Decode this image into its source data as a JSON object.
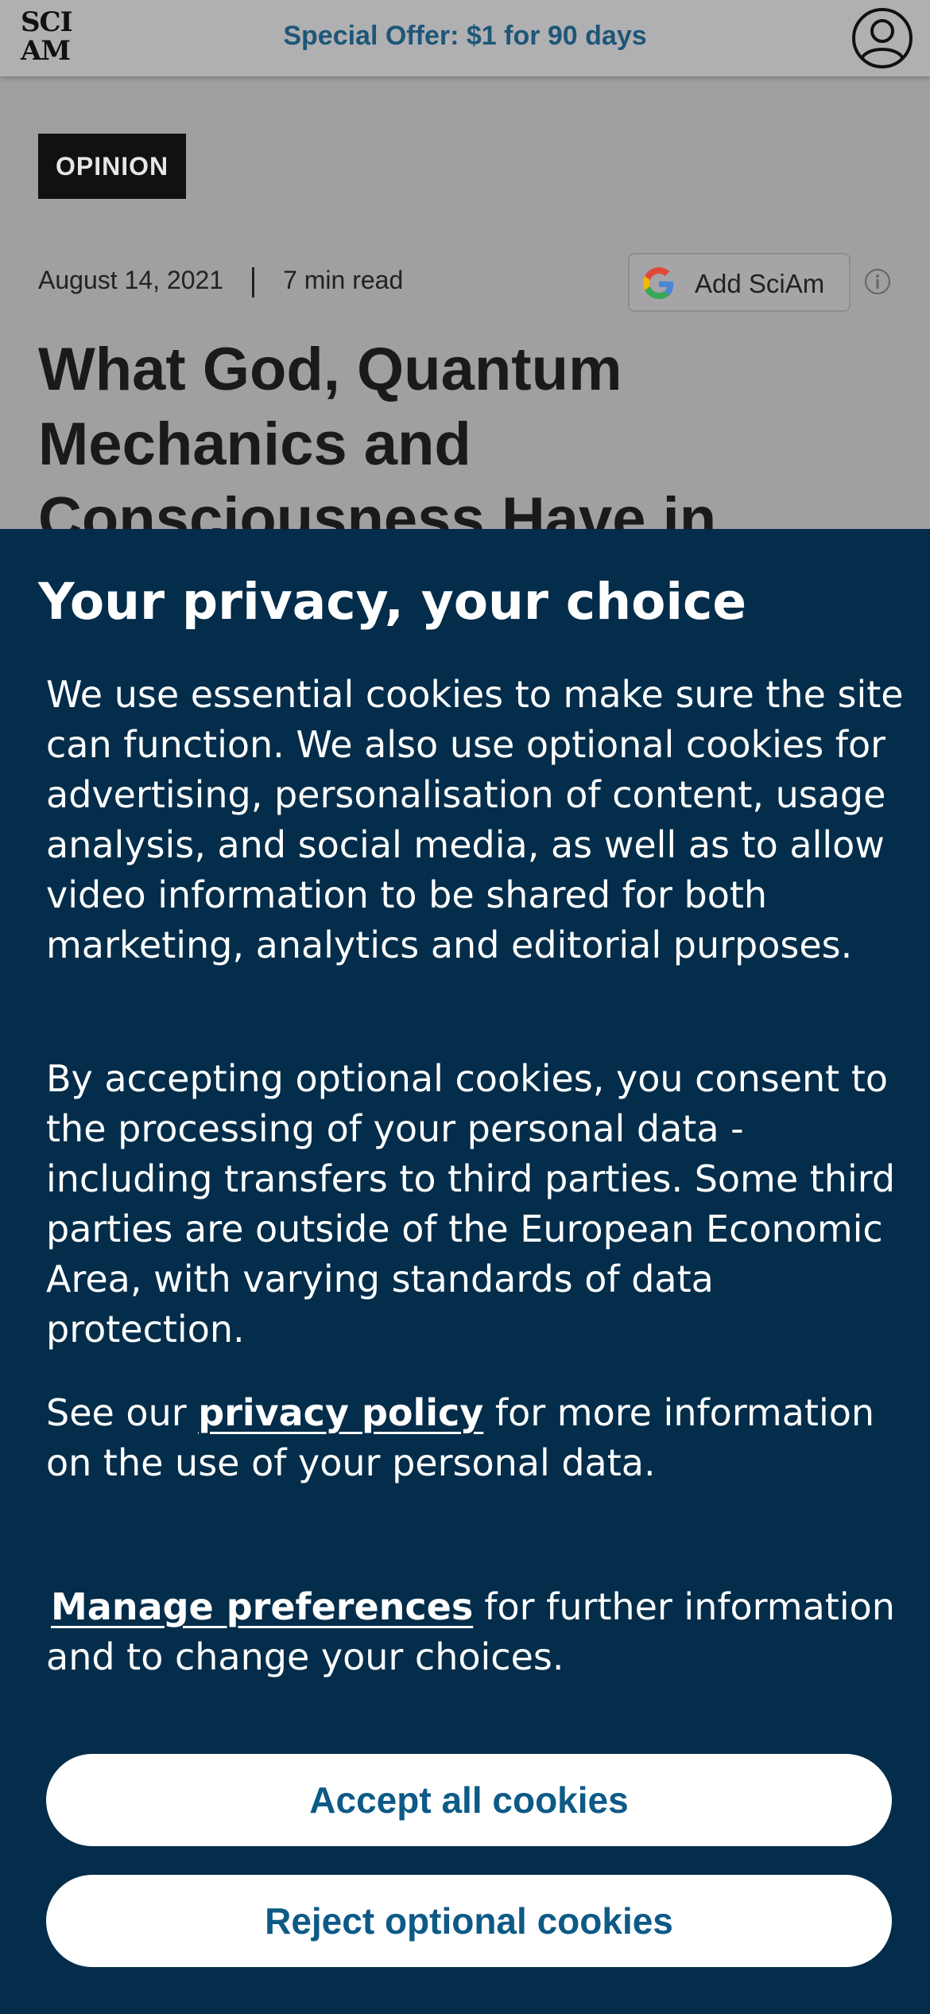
{
  "header": {
    "logo_line1": "SCI",
    "logo_line2": "AM",
    "offer_text": "Special Offer: $1 for 90 days",
    "account_icon": "user-circle-icon"
  },
  "article": {
    "tag": "OPINION",
    "date": "August 14, 2021",
    "read_time": "7 min read",
    "add_button_label": "Add SciAm",
    "add_button_icon": "google-icon",
    "info_icon": "info-icon",
    "headline": "What God, Quantum Mechanics and Consciousness Have in"
  },
  "consent": {
    "title": "Your privacy, your choice",
    "paragraph1": "We use essential cookies to make sure the site can function. We also use optional cookies for advertising, personalisation of content, usage analysis, and social media, as well as to allow video information to be shared for both marketing, analytics and editorial purposes.",
    "paragraph2": "By accepting optional cookies, you consent to the processing of your personal data - including transfers to third parties. Some third parties are outside of the European Economic Area, with varying standards of data protection.",
    "paragraph3_prefix": "See our",
    "privacy_link": "privacy policy",
    "paragraph3_suffix": "for more information on the use of your personal data.",
    "manage_link": "Manage preferences",
    "paragraph4_suffix": "for further information and to change your choices.",
    "accept_button": "Accept all cookies",
    "reject_button": "Reject optional cookies"
  },
  "colors": {
    "consent_background": "#032d4a",
    "button_text": "#0d5a86",
    "offer_text": "#1e5677"
  }
}
